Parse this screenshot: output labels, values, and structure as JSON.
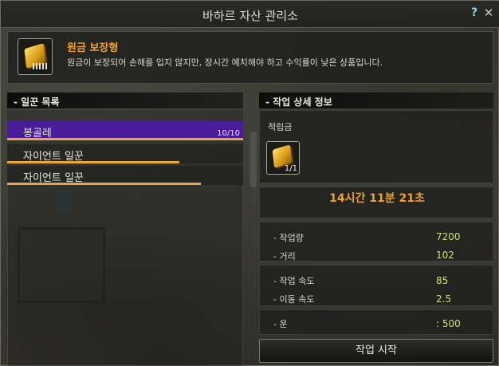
{
  "window": {
    "title": "바하르 자산 관리소",
    "help_label": "?",
    "close_label": "✕"
  },
  "item": {
    "name": "원금 보장형",
    "description": "원금이 보장되어 손해를 입지 않지만, 장시간 예치해야 하고 수익률이 낮은 상품입니다.",
    "icon": "gold-bar-icon"
  },
  "worker_list": {
    "header": "- 일꾼 목록",
    "workers": [
      {
        "name": "봉골레",
        "count": "10/10",
        "stamina": 1.0,
        "selected": true
      },
      {
        "name": "자이언트 일꾼",
        "count": "",
        "stamina": 0.73,
        "selected": false
      },
      {
        "name": "자이언트 일꾼",
        "count": "",
        "stamina": 0.82,
        "selected": false
      }
    ]
  },
  "detail": {
    "header": "- 작업 상세 정보",
    "reward_label": "적립금",
    "reward_qty": "1/1",
    "reward_icon": "gold-bar-icon",
    "time_remaining": "14시간 11분 21초",
    "stats": [
      {
        "label": "- 작업량",
        "value": "7200"
      },
      {
        "label": "- 거리",
        "value": "102"
      },
      {
        "label": "- 작업 속도",
        "value": "85"
      },
      {
        "label": "- 이동 속도",
        "value": "2.5"
      },
      {
        "label": "- 운",
        "value": ": 500"
      }
    ],
    "start_button": "작업 시작"
  },
  "colors": {
    "accent": "#f0a030",
    "selected": "#4a1c9c",
    "stat_value": "#c8e56a",
    "stamina": "#e8a63c"
  }
}
